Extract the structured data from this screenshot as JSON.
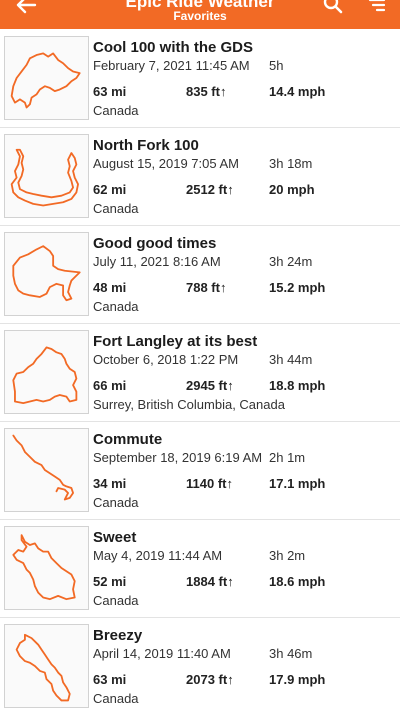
{
  "header": {
    "title": "Epic Ride Weather",
    "subtitle": "Favorites",
    "background_color": "#f26a25",
    "icons": {
      "back": "arrow-left-icon",
      "search": "search-icon",
      "filter": "filter-sort-icon"
    }
  },
  "route_color": "#f26a25",
  "routes": [
    {
      "name": "Cool 100 with the GDS",
      "date": "February 7, 2021 11:45 AM",
      "duration": "5h",
      "distance": "63 mi",
      "elevation": "835 ft↑",
      "speed": "14.4 mph",
      "location": "Canada"
    },
    {
      "name": "North Fork 100",
      "date": "August 15, 2019 7:05 AM",
      "duration": "3h 18m",
      "distance": "62 mi",
      "elevation": "2512 ft↑",
      "speed": "20 mph",
      "location": "Canada"
    },
    {
      "name": "Good good times",
      "date": "July 11, 2021 8:16 AM",
      "duration": "3h 24m",
      "distance": "48 mi",
      "elevation": "788 ft↑",
      "speed": "15.2 mph",
      "location": "Canada"
    },
    {
      "name": "Fort Langley at its best",
      "date": "October 6, 2018 1:22 PM",
      "duration": "3h 44m",
      "distance": "66 mi",
      "elevation": "2945 ft↑",
      "speed": "18.8 mph",
      "location": "Surrey, British Columbia, Canada"
    },
    {
      "name": "Commute",
      "date": "September 18, 2019 6:19 AM",
      "duration": "2h 1m",
      "distance": "34 mi",
      "elevation": "1140 ft↑",
      "speed": "17.1 mph",
      "location": "Canada"
    },
    {
      "name": "Sweet",
      "date": "May 4, 2019 11:44 AM",
      "duration": "3h 2m",
      "distance": "52 mi",
      "elevation": "1884 ft↑",
      "speed": "18.6 mph",
      "location": "Canada"
    },
    {
      "name": "Breezy",
      "date": "April 14, 2019 11:40 AM",
      "duration": "3h 46m",
      "distance": "63 mi",
      "elevation": "2073 ft↑",
      "speed": "17.9 mph",
      "location": "Canada"
    }
  ]
}
